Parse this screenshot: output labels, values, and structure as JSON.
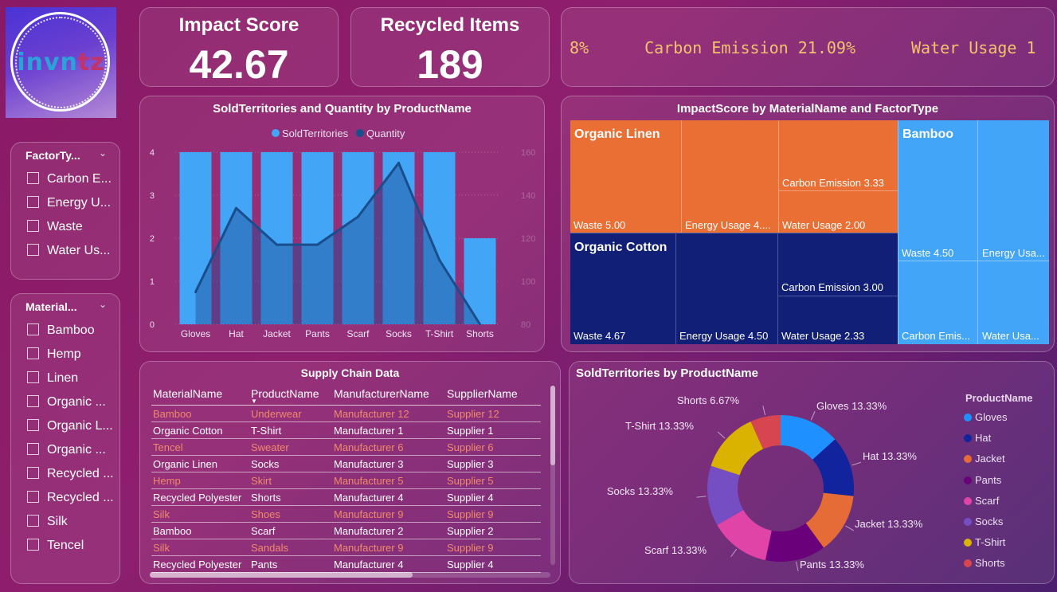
{
  "logo": {
    "part1": "invn",
    "part2": "tz"
  },
  "kpis": [
    {
      "label": "Impact Score",
      "value": "42.67"
    },
    {
      "label": "Recycled Items",
      "value": "189"
    }
  ],
  "ticker": [
    "8%",
    "Carbon Emission 21.09%",
    "Water Usage 1"
  ],
  "slicers": {
    "factor": {
      "title": "FactorTy...",
      "items": [
        "Carbon E...",
        "Energy U...",
        "Waste",
        "Water Us..."
      ]
    },
    "material": {
      "title": "Material...",
      "items": [
        "Bamboo",
        "Hemp",
        "Linen",
        "Organic ...",
        "Organic L...",
        "Organic ...",
        "Recycled ...",
        "Recycled ...",
        "Silk",
        "Tencel"
      ]
    }
  },
  "combo_chart": {
    "title": "SoldTerritories and Quantity by ProductName",
    "legend": [
      "SoldTerritories",
      "Quantity"
    ],
    "colors": {
      "bars": "#42a5f5",
      "line": "#1a4d8c"
    }
  },
  "treemap": {
    "title": "ImpactScore by MaterialName and FactorType",
    "groups": [
      {
        "name": "Organic Linen",
        "color": "#e96f35",
        "cells": [
          "Waste 5.00",
          "Energy Usage 4....",
          "Carbon Emission 3.33",
          "Water Usage 2.00"
        ]
      },
      {
        "name": "Organic Cotton",
        "color": "#111f76",
        "cells": [
          "Waste 4.67",
          "Energy Usage 4.50",
          "Carbon Emission 3.00",
          "Water Usage 2.33"
        ]
      },
      {
        "name": "Bamboo",
        "color": "#42a5f8",
        "cells": [
          "Waste 4.50",
          "Energy Usa...",
          "Carbon Emis...",
          "Water Usa..."
        ]
      }
    ]
  },
  "table": {
    "title": "Supply Chain Data",
    "columns": [
      "MaterialName",
      "ProductName",
      "ManufacturerName",
      "SupplierName"
    ],
    "rows": [
      [
        "Bamboo",
        "Underwear",
        "Manufacturer 12",
        "Supplier 12"
      ],
      [
        "Organic Cotton",
        "T-Shirt",
        "Manufacturer 1",
        "Supplier 1"
      ],
      [
        "Tencel",
        "Sweater",
        "Manufacturer 6",
        "Supplier 6"
      ],
      [
        "Organic Linen",
        "Socks",
        "Manufacturer 3",
        "Supplier 3"
      ],
      [
        "Hemp",
        "Skirt",
        "Manufacturer 5",
        "Supplier 5"
      ],
      [
        "Recycled Polyester",
        "Shorts",
        "Manufacturer 4",
        "Supplier 4"
      ],
      [
        "Silk",
        "Shoes",
        "Manufacturer 9",
        "Supplier 9"
      ],
      [
        "Bamboo",
        "Scarf",
        "Manufacturer 2",
        "Supplier 2"
      ],
      [
        "Silk",
        "Sandals",
        "Manufacturer 9",
        "Supplier 9"
      ],
      [
        "Recycled Polyester",
        "Pants",
        "Manufacturer 4",
        "Supplier 4"
      ]
    ]
  },
  "donut": {
    "title": "SoldTerritories by ProductName",
    "legend_title": "ProductName"
  },
  "chart_data": [
    {
      "type": "bar",
      "title": "SoldTerritories and Quantity by ProductName",
      "categories": [
        "Gloves",
        "Hat",
        "Jacket",
        "Pants",
        "Scarf",
        "Socks",
        "T-Shirt",
        "Shorts"
      ],
      "series": [
        {
          "name": "SoldTerritories",
          "type": "bar",
          "axis": "left",
          "values": [
            4,
            4,
            4,
            4,
            4,
            4,
            4,
            2
          ]
        },
        {
          "name": "Quantity",
          "type": "line",
          "axis": "right",
          "values": [
            95,
            134,
            117,
            117,
            130,
            155,
            110,
            80
          ]
        }
      ],
      "y_left": {
        "ticks": [
          0,
          1,
          2,
          3,
          4
        ],
        "lim": [
          0,
          4
        ]
      },
      "y_right": {
        "ticks": [
          80,
          100,
          120,
          140,
          160
        ],
        "lim": [
          80,
          160
        ]
      },
      "legend": "top"
    },
    {
      "type": "pie",
      "title": "SoldTerritories by ProductName",
      "labels": [
        "Gloves",
        "Hat",
        "Jacket",
        "Pants",
        "Scarf",
        "Socks",
        "T-Shirt",
        "Shorts"
      ],
      "values": [
        13.33,
        13.33,
        13.33,
        13.33,
        13.33,
        13.33,
        13.33,
        6.67
      ],
      "display": [
        "Gloves 13.33%",
        "Hat 13.33%",
        "Jacket 13.33%",
        "Pants 13.33%",
        "Scarf 13.33%",
        "Socks 13.33%",
        "T-Shirt 13.33%",
        "Shorts 6.67%"
      ],
      "colors": [
        "#1e90ff",
        "#12239e",
        "#e66c37",
        "#6b007b",
        "#e044a7",
        "#744ec2",
        "#d9b300",
        "#d64550"
      ],
      "legend": "right"
    }
  ]
}
